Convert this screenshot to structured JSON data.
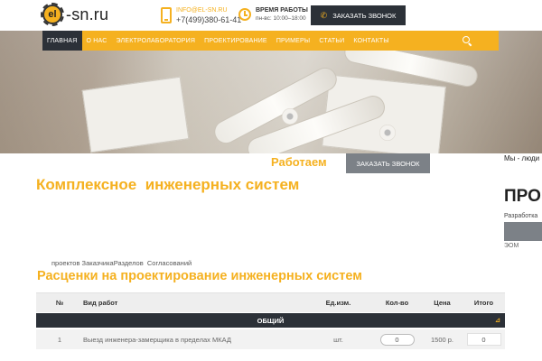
{
  "header": {
    "logo_mark": "el",
    "logo_text": "-sn.ru",
    "email": "info@el-sn.ru",
    "phone": "+7(499)380-61-41",
    "hours_title": "Время работы",
    "hours_value": "пн-вс: 10:00–18:00",
    "call_button": "Заказать звонок"
  },
  "nav": {
    "items": [
      "Главная",
      "О нас",
      "Электролаборатория",
      "Проектирование",
      "Примеры",
      "Статьи",
      "Контакты"
    ]
  },
  "hero": {
    "working_text": "Работаем",
    "call_button": "Заказать звонок"
  },
  "content": {
    "main_title": "Комплексное  инженерных систем",
    "steps": [
      "проектов",
      "Заказчика",
      "Разделов",
      "Согласований"
    ],
    "price_title": "Расценки на проектирование инженерных систем"
  },
  "side": {
    "note": "Мы - люди",
    "heading": "ПРО",
    "sub": "Разработка",
    "eom": "ЭОМ"
  },
  "table": {
    "headers": {
      "n": "№",
      "work": "Вид работ",
      "unit": "Ед.изм.",
      "qty": "Кол-во",
      "price": "Цена",
      "total": "Итого"
    },
    "group": "ОБЩИЙ",
    "rows": [
      {
        "n": "1",
        "work": "Выезд инженера-замерщика в пределах МКАД",
        "unit": "шт.",
        "qty": "0",
        "price": "1500 р.",
        "total": "0"
      }
    ]
  },
  "colors": {
    "accent": "#f5b120",
    "dark": "#2c3138",
    "grey_button": "#7c8187"
  }
}
